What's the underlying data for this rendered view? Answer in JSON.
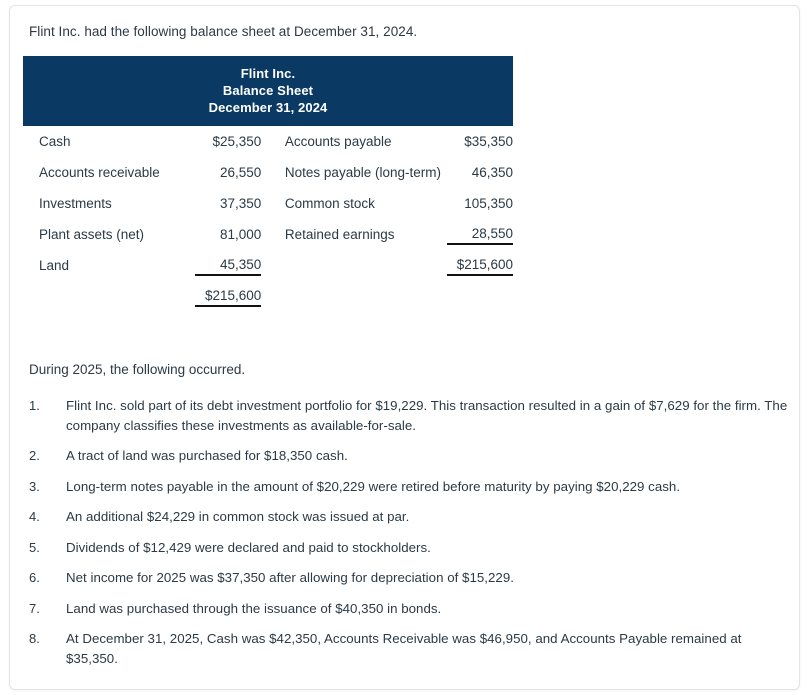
{
  "intro": "Flint Inc. had the following balance sheet at December 31, 2024.",
  "balance_sheet": {
    "banner": {
      "company": "Flint Inc.",
      "statement": "Balance Sheet",
      "date": "December 31, 2024"
    },
    "assets": [
      {
        "label": "Cash",
        "value": "$25,350"
      },
      {
        "label": "Accounts receivable",
        "value": "26,550"
      },
      {
        "label": "Investments",
        "value": "37,350"
      },
      {
        "label": "Plant assets (net)",
        "value": "81,000"
      },
      {
        "label": "Land",
        "value": "45,350"
      }
    ],
    "assets_total": "$215,600",
    "liabilities_equity": [
      {
        "label": "Accounts payable",
        "value": "$35,350"
      },
      {
        "label": "Notes payable (long-term)",
        "value": "46,350"
      },
      {
        "label": "Common stock",
        "value": "105,350"
      },
      {
        "label": "Retained earnings",
        "value": "28,550"
      }
    ],
    "liabilities_equity_total": "$215,600",
    "banner_color": "#0a3a63"
  },
  "during_heading": "During 2025, the following occurred.",
  "events": [
    {
      "num": "1.",
      "text": "Flint Inc. sold part of its debt investment portfolio for $19,229. This transaction resulted in a gain of $7,629 for the firm. The company classifies these investments as available-for-sale."
    },
    {
      "num": "2.",
      "text": "A tract of land was purchased for $18,350 cash."
    },
    {
      "num": "3.",
      "text": "Long-term notes payable in the amount of $20,229 were retired before maturity by paying $20,229 cash."
    },
    {
      "num": "4.",
      "text": "An additional $24,229 in common stock was issued at par."
    },
    {
      "num": "5.",
      "text": "Dividends of $12,429 were declared and paid to stockholders."
    },
    {
      "num": "6.",
      "text": "Net income for 2025 was $37,350 after allowing for depreciation of $15,229."
    },
    {
      "num": "7.",
      "text": "Land was purchased through the issuance of $40,350 in bonds."
    },
    {
      "num": "8.",
      "text": "At December 31, 2025, Cash was $42,350, Accounts Receivable was $46,950, and Accounts Payable remained at $35,350."
    }
  ]
}
